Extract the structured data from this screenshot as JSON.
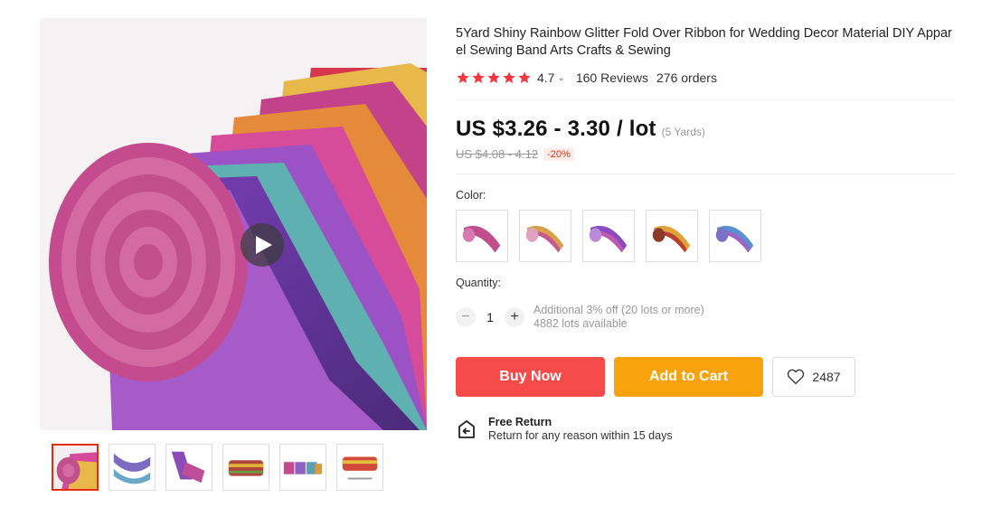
{
  "product": {
    "title": "5Yard Shiny Rainbow Glitter Fold Over Ribbon for Wedding Decor Material DIY Apparel Sewing Band Arts Crafts & Sewing",
    "rating": "4.7",
    "reviews": "160 Reviews",
    "orders": "276 orders",
    "stars_filled": 5
  },
  "price": {
    "current": "US $3.26 - 3.30 / lot",
    "unit_note": "(5 Yards)",
    "original": "US $4.08 - 4.12",
    "discount": "-20%"
  },
  "color": {
    "label": "Color:",
    "options": [
      "pink-glitter-ribbon",
      "gold-pink-glitter-ribbon",
      "purple-glitter-ribbon",
      "gold-red-glitter-ribbon",
      "blue-purple-glitter-ribbon"
    ]
  },
  "quantity": {
    "label": "Quantity:",
    "value": "1",
    "decrement": "−",
    "increment": "+",
    "note_discount": "Additional 3% off (20 lots or more)",
    "note_available": "4882 lots available"
  },
  "actions": {
    "buy_now": "Buy Now",
    "add_to_cart": "Add to Cart",
    "wishlist_count": "2487"
  },
  "return_policy": {
    "title": "Free Return",
    "subtitle": "Return for any reason within 15 days"
  },
  "colors": {
    "buy": "#f54b4b",
    "cart": "#f8a20c",
    "accent": "#e62e04",
    "star": "#f5363e"
  }
}
